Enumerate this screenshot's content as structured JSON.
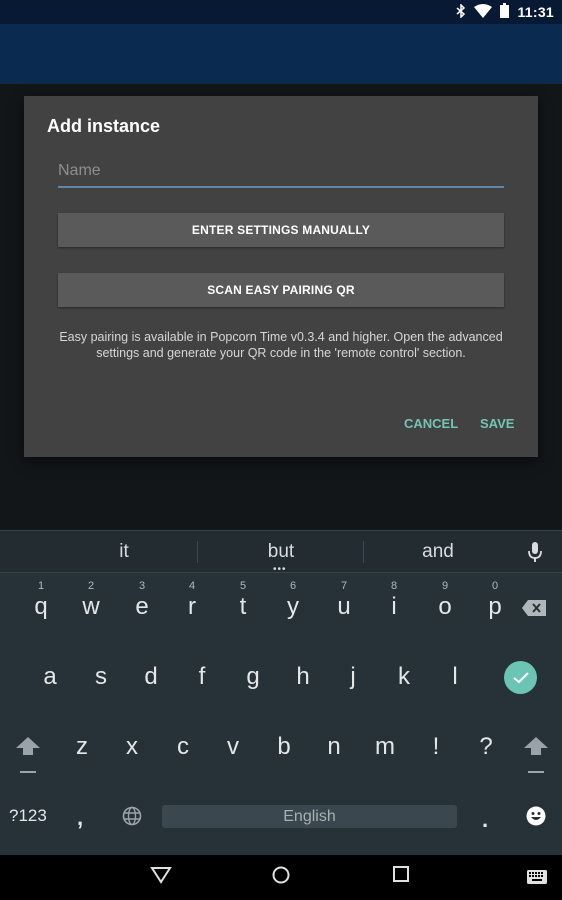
{
  "status_bar": {
    "time": "11:31",
    "icons": [
      "bluetooth-icon",
      "wifi-icon",
      "battery-icon"
    ]
  },
  "dialog": {
    "title": "Add instance",
    "name_placeholder": "Name",
    "name_value": "",
    "enter_manually_label": "ENTER SETTINGS MANUALLY",
    "scan_qr_label": "SCAN EASY PAIRING QR",
    "info_text": "Easy pairing is available in Popcorn Time v0.3.4 and higher. Open the advanced settings and generate your QR code in the 'remote control' section.",
    "cancel_label": "CANCEL",
    "save_label": "SAVE"
  },
  "colors": {
    "accent": "#74c4b5",
    "app_bar": "#0a2a50",
    "dialog_bg": "#424242",
    "input_underline": "#5f86a8",
    "keyboard_bg": "#263238"
  },
  "keyboard": {
    "suggestions": [
      "it",
      "but",
      "and"
    ],
    "row1": [
      "q",
      "w",
      "e",
      "r",
      "t",
      "y",
      "u",
      "i",
      "o",
      "p"
    ],
    "row1_hints": [
      "1",
      "2",
      "3",
      "4",
      "5",
      "6",
      "7",
      "8",
      "9",
      "0"
    ],
    "row2": [
      "a",
      "s",
      "d",
      "f",
      "g",
      "h",
      "j",
      "k",
      "l"
    ],
    "row3": [
      "z",
      "x",
      "c",
      "v",
      "b",
      "n",
      "m",
      "!",
      "?"
    ],
    "symbols_label": "?123",
    "comma": ",",
    "period": ".",
    "space_label": "English"
  }
}
